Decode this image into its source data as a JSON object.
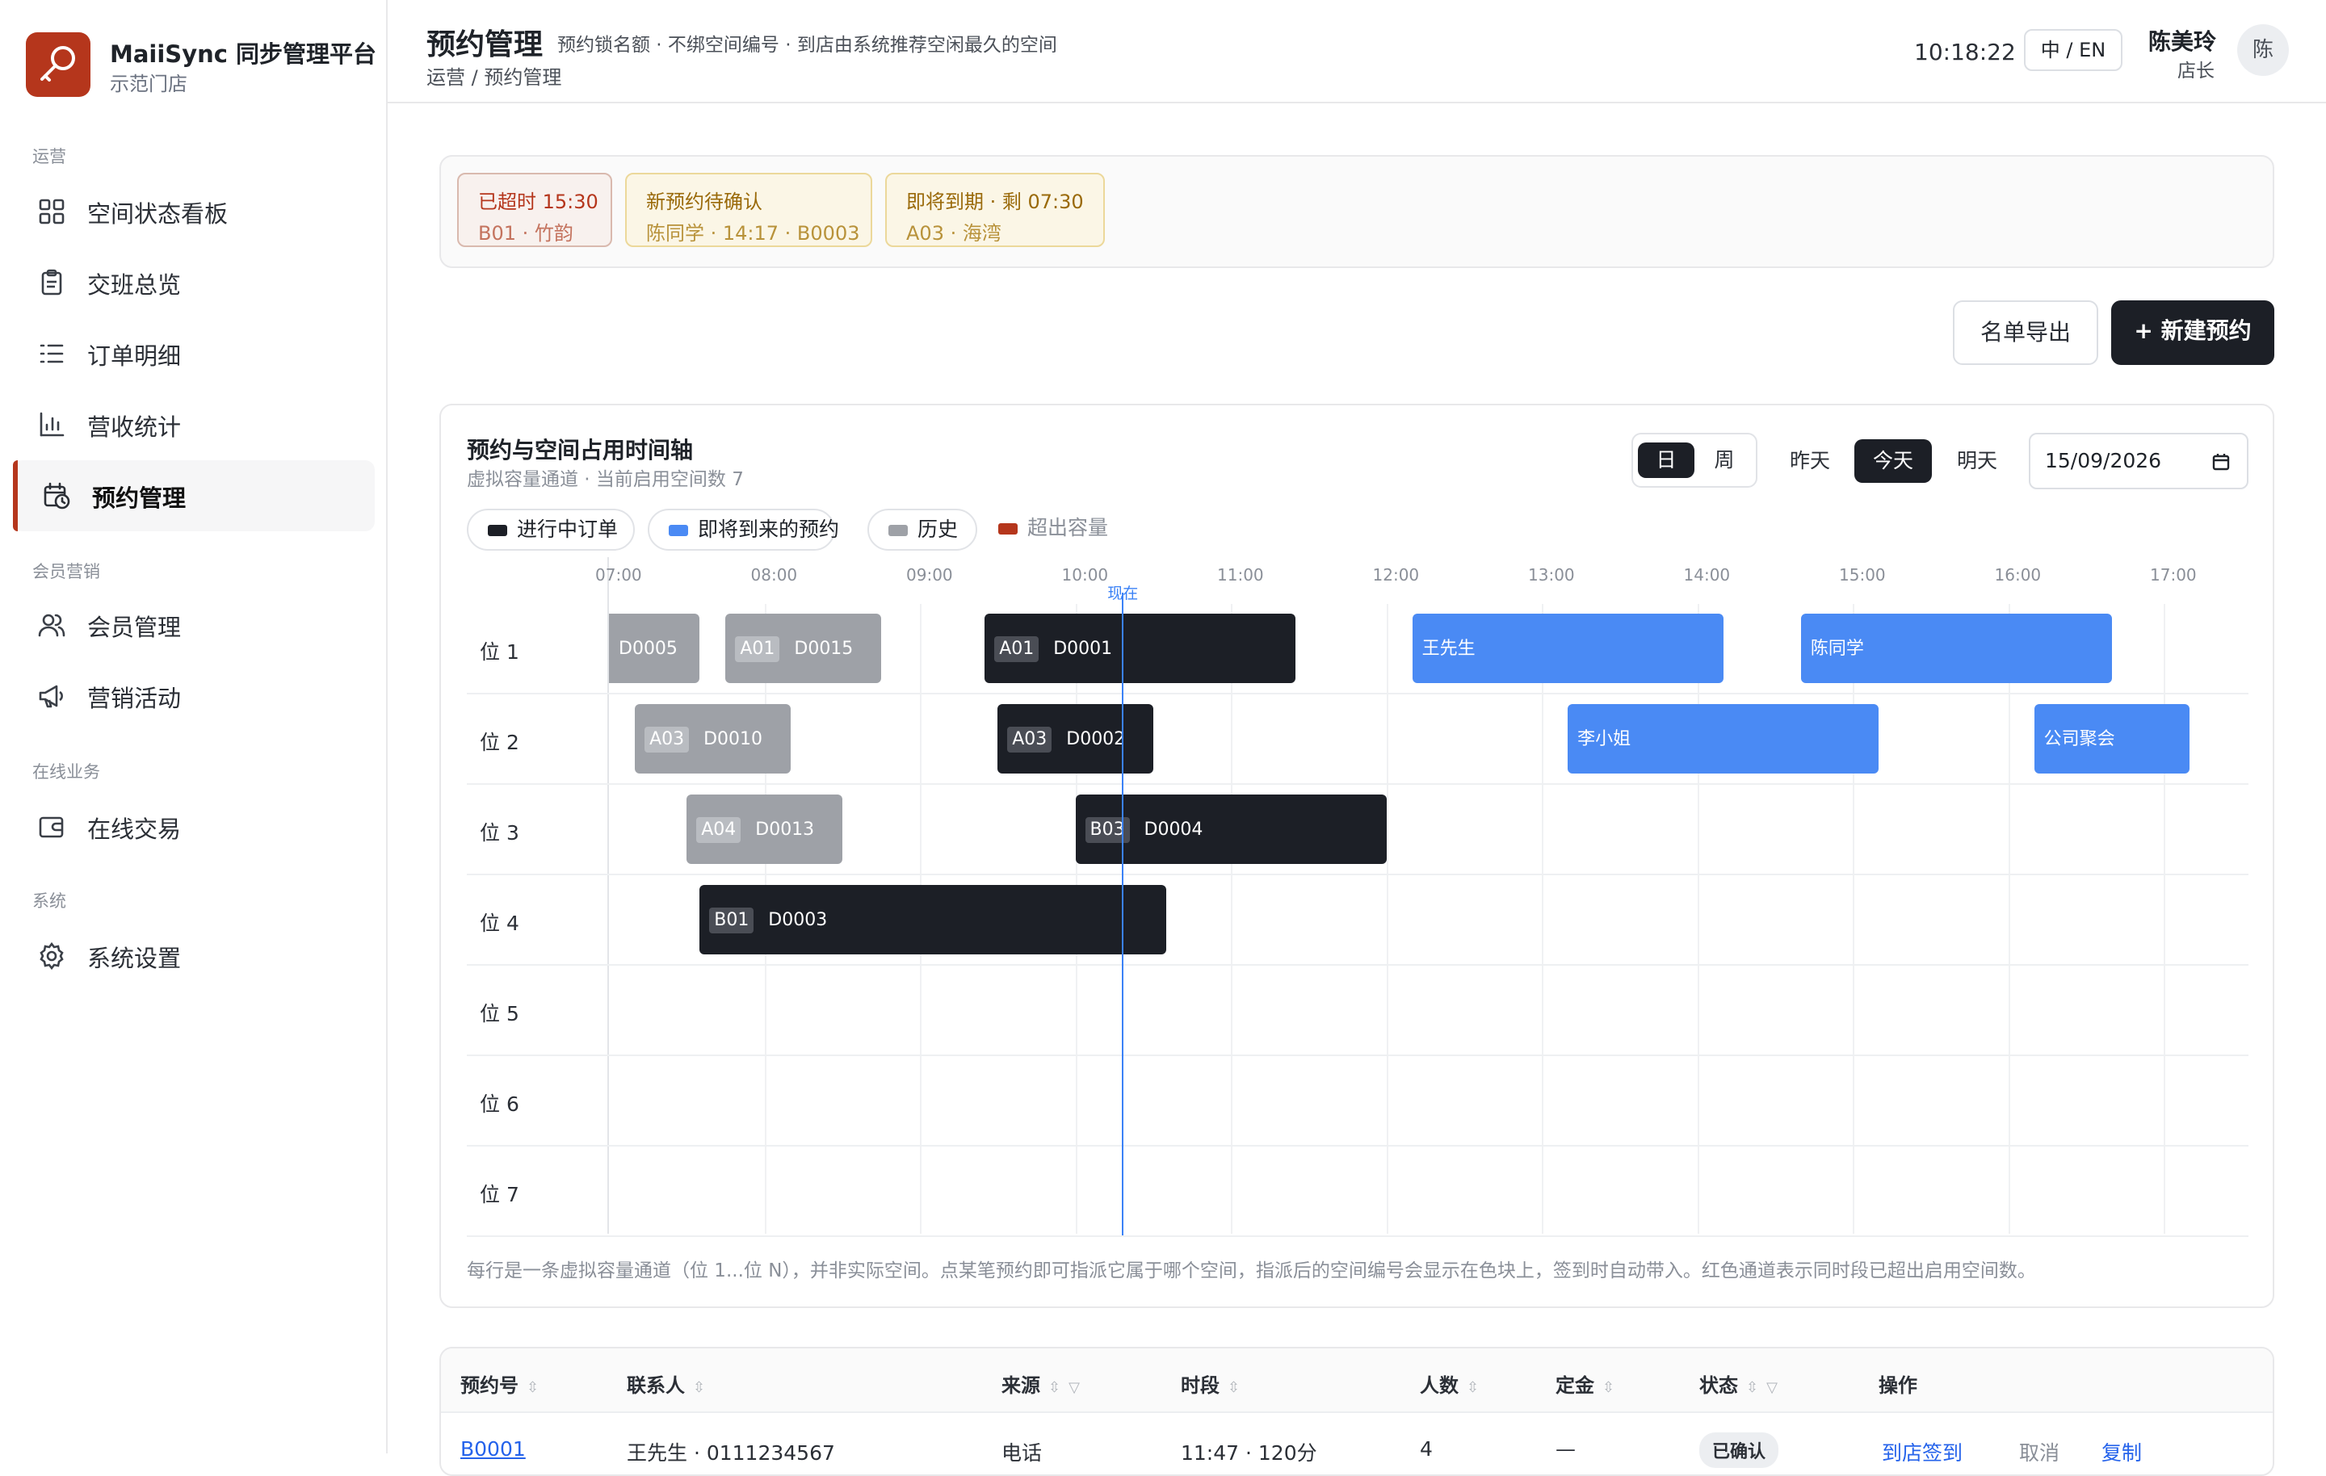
{
  "brand": {
    "title": "MaiiSync 同步管理平台",
    "store": "示范门店",
    "color": "#b5361c"
  },
  "sidebar": {
    "sections": [
      {
        "label": "运营"
      },
      {
        "label": "会员营销"
      },
      {
        "label": "在线业务"
      },
      {
        "label": "系统"
      }
    ],
    "items": [
      {
        "label": "空间状态看板",
        "icon": "grid-icon"
      },
      {
        "label": "交班总览",
        "icon": "clipboard-icon"
      },
      {
        "label": "订单明细",
        "icon": "list-icon"
      },
      {
        "label": "营收统计",
        "icon": "bar-chart-icon"
      },
      {
        "label": "预约管理",
        "icon": "calendar-clock-icon",
        "active": true
      },
      {
        "label": "会员管理",
        "icon": "users-icon"
      },
      {
        "label": "营销活动",
        "icon": "megaphone-icon"
      },
      {
        "label": "在线交易",
        "icon": "wallet-icon"
      },
      {
        "label": "系统设置",
        "icon": "gear-icon"
      }
    ]
  },
  "header": {
    "title": "预约管理",
    "subtitle": "预约锁名额 · 不绑空间编号 · 到店由系统推荐空闲最久的空间",
    "breadcrumb": "运营 / 预约管理",
    "clock": "10:18:22",
    "lang": "中 / EN",
    "user": {
      "name": "陈美玲",
      "role": "店长",
      "avatar": "陈"
    }
  },
  "alerts": [
    {
      "title": "已超时 15:30",
      "sub": "B01 · 竹韵",
      "color": "#b5361c"
    },
    {
      "title": "新预约待确认",
      "sub": "陈同学 · 14:17 · B0003",
      "color": "#a16207"
    },
    {
      "title": "即将到期 · 剩 07:30",
      "sub": "A03 · 海湾",
      "color": "#a16207"
    }
  ],
  "actions": {
    "export": "名单导出",
    "new": "+ 新建预约"
  },
  "timeline": {
    "title": "预约与空间占用时间轴",
    "subtitle": "虚拟容量通道 · 当前启用空间数 7",
    "view_day": "日",
    "view_week": "周",
    "yesterday": "昨天",
    "today": "今天",
    "tomorrow": "明天",
    "date": "15/09/2026",
    "legend": [
      {
        "label": "进行中订单",
        "color": "#1c1f26"
      },
      {
        "label": "即将到来的预约",
        "color": "#4a8af4"
      },
      {
        "label": "历史",
        "color": "#9ea1a7"
      },
      {
        "label": "超出容量",
        "color": "#b5361c"
      }
    ],
    "hours": [
      "07:00",
      "08:00",
      "09:00",
      "10:00",
      "11:00",
      "12:00",
      "13:00",
      "14:00",
      "15:00",
      "16:00",
      "17:00"
    ],
    "lanes": [
      "位 1",
      "位 2",
      "位 3",
      "位 4",
      "位 5",
      "位 6",
      "位 7"
    ],
    "now_label": "现在",
    "now_time": "10:18",
    "bookings": [
      {
        "lane": 0,
        "start": "06:55",
        "end": "07:35",
        "space": "",
        "code": "D0005",
        "kind": "history"
      },
      {
        "lane": 0,
        "start": "07:45",
        "end": "08:45",
        "space": "A01",
        "code": "D0015",
        "kind": "history"
      },
      {
        "lane": 0,
        "start": "09:25",
        "end": "11:25",
        "space": "A01",
        "code": "D0001",
        "kind": "active"
      },
      {
        "lane": 0,
        "start": "12:10",
        "end": "14:10",
        "space": "",
        "code": "王先生",
        "kind": "upcoming"
      },
      {
        "lane": 0,
        "start": "14:40",
        "end": "16:40",
        "space": "",
        "code": "陈同学",
        "kind": "upcoming"
      },
      {
        "lane": 1,
        "start": "07:10",
        "end": "08:10",
        "space": "A03",
        "code": "D0010",
        "kind": "history"
      },
      {
        "lane": 1,
        "start": "09:30",
        "end": "10:30",
        "space": "A03",
        "code": "D0002",
        "kind": "active"
      },
      {
        "lane": 1,
        "start": "13:10",
        "end": "15:10",
        "space": "",
        "code": "李小姐",
        "kind": "upcoming"
      },
      {
        "lane": 1,
        "start": "16:10",
        "end": "17:10",
        "space": "",
        "code": "公司聚会",
        "kind": "upcoming"
      },
      {
        "lane": 2,
        "start": "07:30",
        "end": "08:30",
        "space": "A04",
        "code": "D0013",
        "kind": "history"
      },
      {
        "lane": 2,
        "start": "10:00",
        "end": "12:00",
        "space": "B03",
        "code": "D0004",
        "kind": "active"
      },
      {
        "lane": 3,
        "start": "07:35",
        "end": "10:35",
        "space": "B01",
        "code": "D0003",
        "kind": "active"
      }
    ],
    "note": "每行是一条虚拟容量通道（位 1...位 N），并非实际空间。点某笔预约即可指派它属于哪个空间，指派后的空间编号会显示在色块上，签到时自动带入。红色通道表示同时段已超出启用空间数。"
  },
  "table": {
    "headers": [
      {
        "label": "预约号",
        "icons": "sort"
      },
      {
        "label": "联系人",
        "icons": "sort"
      },
      {
        "label": "来源",
        "icons": "sort-filter"
      },
      {
        "label": "时段",
        "icons": "sort"
      },
      {
        "label": "人数",
        "icons": "sort"
      },
      {
        "label": "定金",
        "icons": "sort"
      },
      {
        "label": "状态",
        "icons": "sort-filter"
      },
      {
        "label": "操作",
        "icons": ""
      }
    ],
    "rows": [
      {
        "id": "B0001",
        "contact": "王先生 · 0111234567",
        "source": "电话",
        "slot": "11:47 · 120分",
        "people": "4",
        "deposit": "—",
        "status": "已确认",
        "actions": [
          "到店签到",
          "取消",
          "复制"
        ]
      }
    ]
  }
}
